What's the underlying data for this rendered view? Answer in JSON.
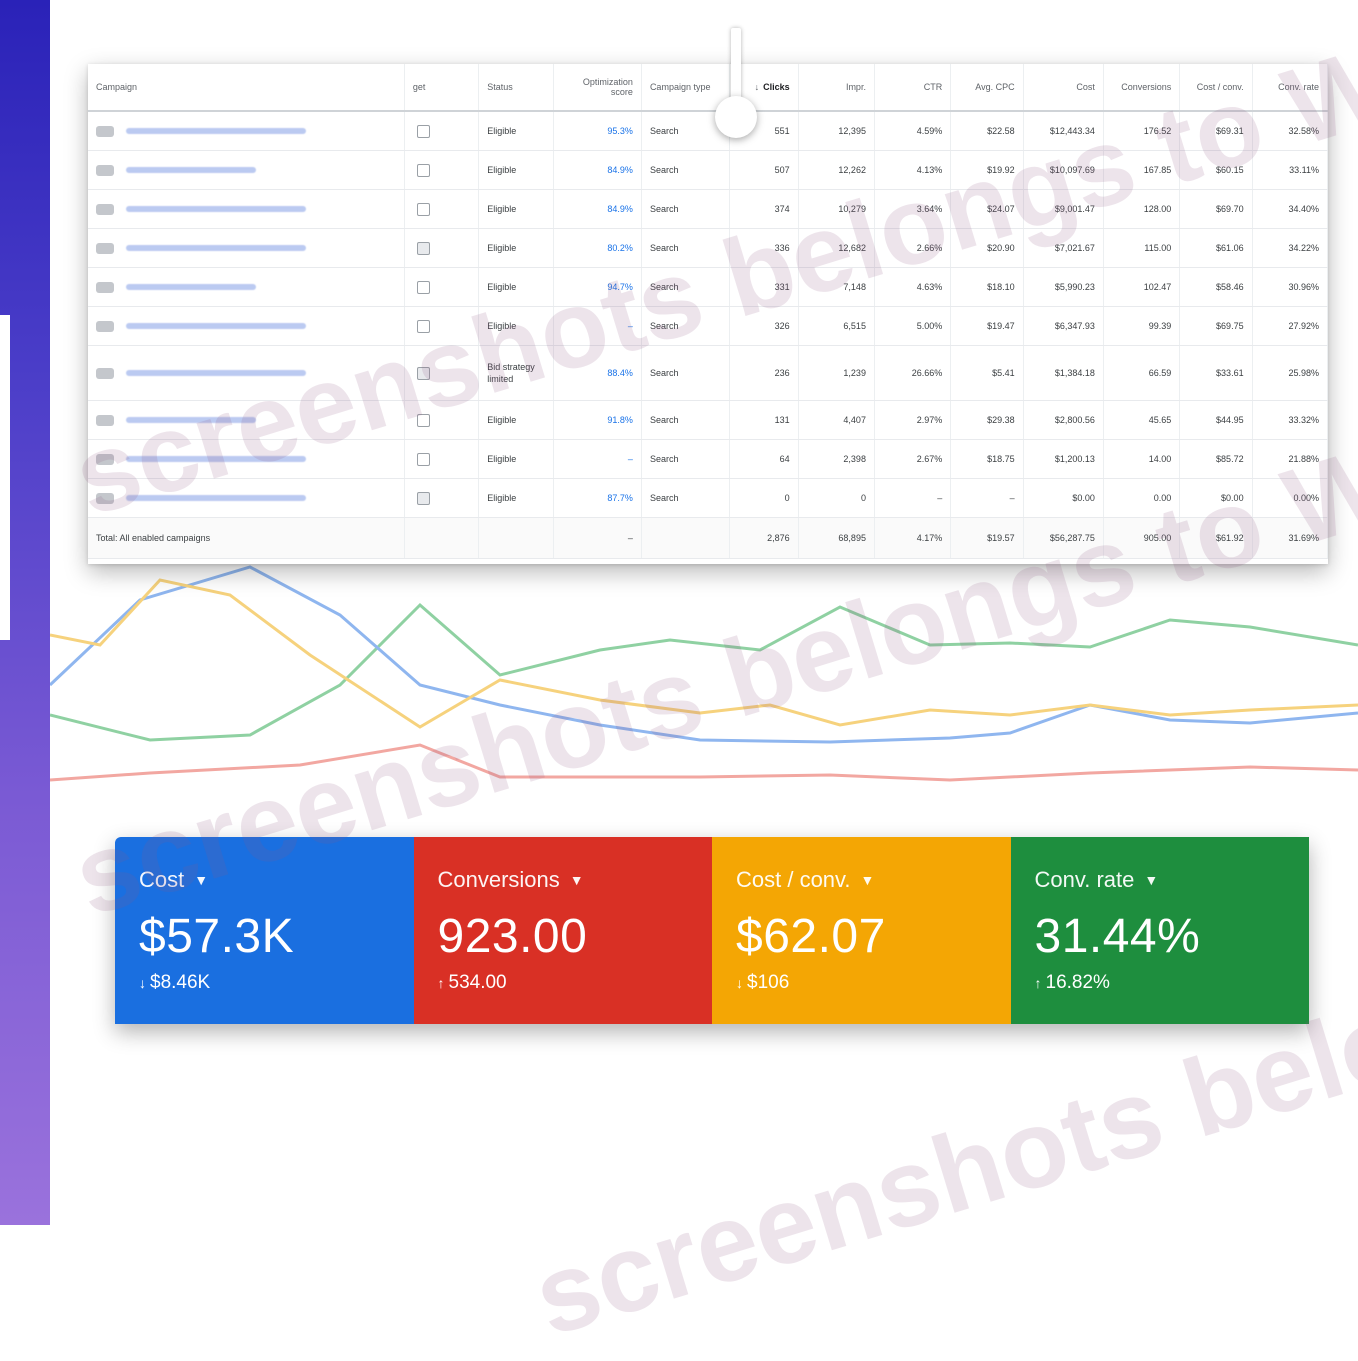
{
  "colors": {
    "cost": "#1a6fe0",
    "conversions": "#d93025",
    "cost_per_conv": "#f4a604",
    "conv_rate": "#1e8e3e",
    "band_top": "#2a22b8",
    "band_bottom": "#9a72dc"
  },
  "table": {
    "headers": {
      "campaign": "Campaign",
      "budget": "get",
      "status": "Status",
      "opt_score": "Optimization score",
      "campaign_type": "Campaign type",
      "clicks": "Clicks",
      "impr": "Impr.",
      "ctr": "CTR",
      "avg_cpc": "Avg. CPC",
      "cost": "Cost",
      "conversions": "Conversions",
      "cost_conv": "Cost / conv.",
      "conv_rate": "Conv. rate"
    },
    "rows": [
      {
        "status": "Eligible",
        "opt": "95.3%",
        "type": "Search",
        "clicks": "551",
        "impr": "12,395",
        "ctr": "4.59%",
        "cpc": "$22.58",
        "cost": "$12,443.34",
        "conv": "176.52",
        "cost_conv": "$69.31",
        "rate": "32.58%"
      },
      {
        "status": "Eligible",
        "opt": "84.9%",
        "type": "Search",
        "clicks": "507",
        "impr": "12,262",
        "ctr": "4.13%",
        "cpc": "$19.92",
        "cost": "$10,097.69",
        "conv": "167.85",
        "cost_conv": "$60.15",
        "rate": "33.11%"
      },
      {
        "status": "Eligible",
        "opt": "84.9%",
        "type": "Search",
        "clicks": "374",
        "impr": "10,279",
        "ctr": "3.64%",
        "cpc": "$24.07",
        "cost": "$9,001.47",
        "conv": "128.00",
        "cost_conv": "$69.70",
        "rate": "34.40%"
      },
      {
        "status": "Eligible",
        "opt": "80.2%",
        "type": "Search",
        "clicks": "336",
        "impr": "12,682",
        "ctr": "2.66%",
        "cpc": "$20.90",
        "cost": "$7,021.67",
        "conv": "115.00",
        "cost_conv": "$61.06",
        "rate": "34.22%"
      },
      {
        "status": "Eligible",
        "opt": "94.7%",
        "type": "Search",
        "clicks": "331",
        "impr": "7,148",
        "ctr": "4.63%",
        "cpc": "$18.10",
        "cost": "$5,990.23",
        "conv": "102.47",
        "cost_conv": "$58.46",
        "rate": "30.96%"
      },
      {
        "status": "Eligible",
        "opt": "–",
        "type": "Search",
        "clicks": "326",
        "impr": "6,515",
        "ctr": "5.00%",
        "cpc": "$19.47",
        "cost": "$6,347.93",
        "conv": "99.39",
        "cost_conv": "$69.75",
        "rate": "27.92%"
      },
      {
        "status": "Bid strategy limited",
        "opt": "88.4%",
        "type": "Search",
        "clicks": "236",
        "impr": "1,239",
        "ctr": "26.66%",
        "cpc": "$5.41",
        "cost": "$1,384.18",
        "conv": "66.59",
        "cost_conv": "$33.61",
        "rate": "25.98%"
      },
      {
        "status": "Eligible",
        "opt": "91.8%",
        "type": "Search",
        "clicks": "131",
        "impr": "4,407",
        "ctr": "2.97%",
        "cpc": "$29.38",
        "cost": "$2,800.56",
        "conv": "45.65",
        "cost_conv": "$44.95",
        "rate": "33.32%"
      },
      {
        "status": "Eligible",
        "opt": "–",
        "type": "Search",
        "clicks": "64",
        "impr": "2,398",
        "ctr": "2.67%",
        "cpc": "$18.75",
        "cost": "$1,200.13",
        "conv": "14.00",
        "cost_conv": "$85.72",
        "rate": "21.88%"
      },
      {
        "status": "Eligible",
        "opt": "87.7%",
        "type": "Search",
        "clicks": "0",
        "impr": "0",
        "ctr": "–",
        "cpc": "–",
        "cost": "$0.00",
        "conv": "0.00",
        "cost_conv": "$0.00",
        "rate": "0.00%"
      }
    ],
    "total": {
      "label": "Total: All enabled campaigns",
      "opt": "–",
      "clicks": "2,876",
      "impr": "68,895",
      "ctr": "4.17%",
      "cpc": "$19.57",
      "cost": "$56,287.75",
      "conv": "905.00",
      "cost_conv": "$61.92",
      "rate": "31.69%"
    }
  },
  "scorecards": [
    {
      "label": "Cost",
      "value": "$57.3K",
      "delta": "$8.46K",
      "direction": "down",
      "icon": "caret-down-icon"
    },
    {
      "label": "Conversions",
      "value": "923.00",
      "delta": "534.00",
      "direction": "up",
      "icon": "caret-down-icon"
    },
    {
      "label": "Cost / conv.",
      "value": "$62.07",
      "delta": "$106",
      "direction": "down",
      "icon": "caret-down-icon"
    },
    {
      "label": "Conv. rate",
      "value": "31.44%",
      "delta": "16.82%",
      "direction": "up",
      "icon": "caret-down-icon"
    }
  ],
  "watermark": "screenshots belongs to WAM"
}
